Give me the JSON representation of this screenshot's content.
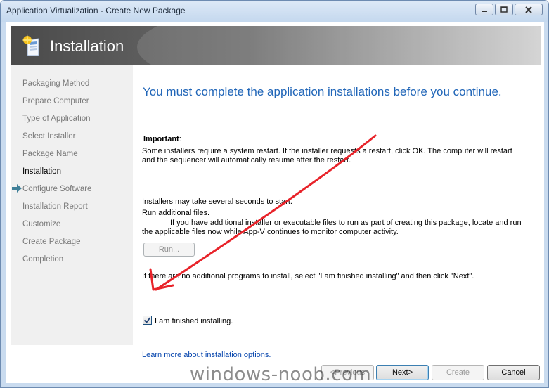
{
  "window": {
    "title": "Application Virtualization - Create New Package"
  },
  "banner": {
    "title": "Installation"
  },
  "nav": {
    "items": [
      {
        "label": "Packaging Method",
        "active": false
      },
      {
        "label": "Prepare Computer",
        "active": false
      },
      {
        "label": "Type of Application",
        "active": false
      },
      {
        "label": "Select Installer",
        "active": false
      },
      {
        "label": "Package Name",
        "active": false
      },
      {
        "label": "Installation",
        "active": true
      },
      {
        "label": "Configure Software",
        "active": false
      },
      {
        "label": "Installation Report",
        "active": false
      },
      {
        "label": "Customize",
        "active": false
      },
      {
        "label": "Create Package",
        "active": false
      },
      {
        "label": "Completion",
        "active": false
      }
    ]
  },
  "main": {
    "headline": "You must complete the application installations before you continue.",
    "important_label": "Important",
    "important_colon": ":",
    "important_line1": "Some installers require a system restart. If the installer requests a restart, click OK. The computer will restart",
    "important_line2": "and the sequencer will automatically resume after the restart.",
    "installers_note": "Installers may take several seconds to start.",
    "run_additional": "Run additional files.",
    "run_line1": "If you have additional installer or executable files to run as part of creating this package, locate and run",
    "run_line2": "the applicable files now while App-V continues to monitor computer activity.",
    "run_button": "Run...",
    "no_programs": "If there are no additional programs to install, select \"I am finished installing\" and then click \"Next\".",
    "finished_checkbox_label": "I am finished installing.",
    "finished_checked": true,
    "learn_more_link": "Learn more about installation options."
  },
  "buttons": {
    "previous": "<Previous",
    "next": "Next>",
    "create": "Create",
    "cancel": "Cancel"
  },
  "watermark": "windows-noob.com",
  "annotation_color": "#e8232a"
}
